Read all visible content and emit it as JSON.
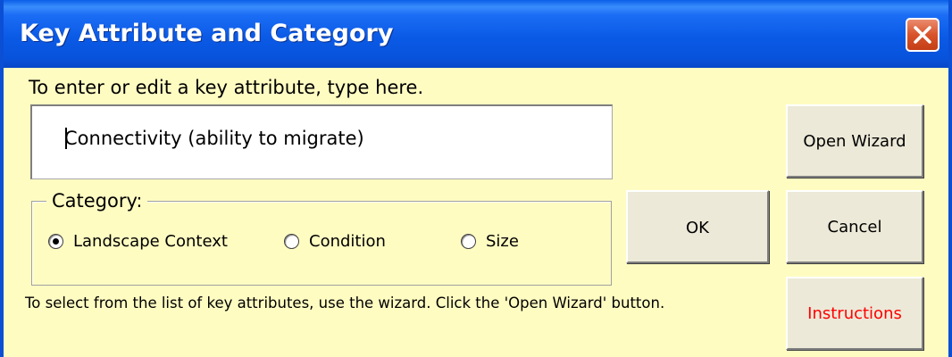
{
  "window": {
    "title": "Key Attribute and Category",
    "close_icon": "close-icon"
  },
  "form": {
    "prompt": "To enter or edit a key attribute, type here.",
    "attribute_value": "Connectivity (ability to migrate)",
    "category_label": "Category:",
    "categories": [
      {
        "label": "Landscape Context",
        "selected": true
      },
      {
        "label": "Condition",
        "selected": false
      },
      {
        "label": "Size",
        "selected": false
      }
    ],
    "hint": "To select from the list of key attributes, use the wizard.  Click the 'Open Wizard' button."
  },
  "buttons": {
    "open_wizard": "Open Wizard",
    "ok": "OK",
    "cancel": "Cancel",
    "instructions": "Instructions"
  },
  "colors": {
    "dialog_background": "#fffcc2",
    "titlebar_blue": "#0a5ae6",
    "close_button_red": "#d9532a",
    "instructions_text": "#ff0000"
  }
}
